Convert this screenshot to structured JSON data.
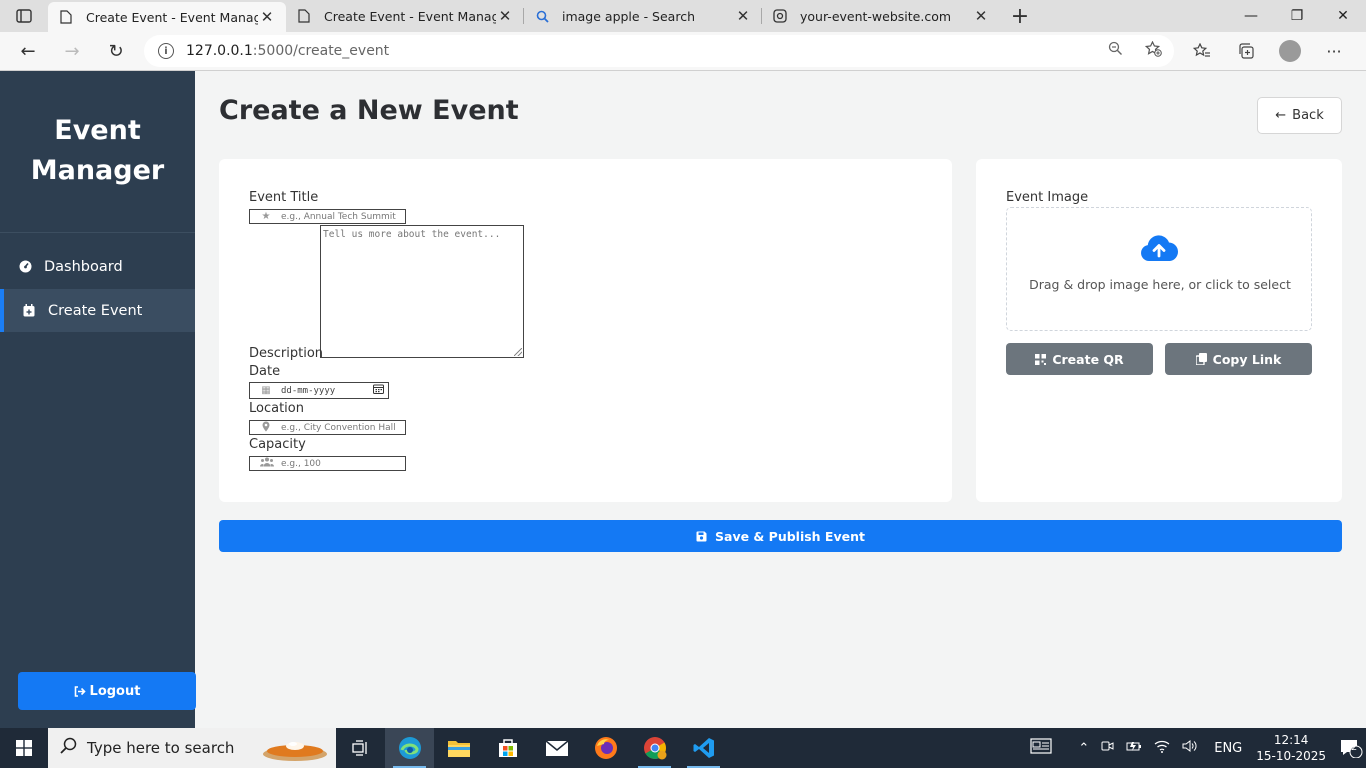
{
  "browser": {
    "tabs": [
      {
        "title": "Create Event - Event Manager",
        "icon": "page-icon",
        "active": true
      },
      {
        "title": "Create Event - Event Manager",
        "icon": "page-icon",
        "active": false
      },
      {
        "title": "image apple - Search",
        "icon": "search-icon",
        "active": false
      },
      {
        "title": "your-event-website.com",
        "icon": "page-icon",
        "active": false
      }
    ],
    "url_host": "127.0.0.1",
    "url_path": ":5000/create_event"
  },
  "sidebar": {
    "brand_line1": "Event",
    "brand_line2": "Manager",
    "items": [
      {
        "label": "Dashboard",
        "icon": "gauge-icon",
        "active": false
      },
      {
        "label": "Create Event",
        "icon": "calendar-plus-icon",
        "active": true
      }
    ],
    "logout_label": "Logout"
  },
  "main": {
    "title": "Create a New Event",
    "back_label": "Back",
    "form": {
      "title_label": "Event Title",
      "title_placeholder": "e.g., Annual Tech Summit",
      "description_label": "Description",
      "description_placeholder": "Tell us more about the event...",
      "date_label": "Date",
      "date_placeholder": "dd-mm-yyyy",
      "location_label": "Location",
      "location_placeholder": "e.g., City Convention Hall",
      "capacity_label": "Capacity",
      "capacity_placeholder": "e.g., 100"
    },
    "image": {
      "label": "Event Image",
      "drop_text": "Drag & drop image here, or click to select",
      "create_qr_label": "Create QR",
      "copy_link_label": "Copy Link"
    },
    "save_label": "Save & Publish Event"
  },
  "taskbar": {
    "search_placeholder": "Type here to search",
    "language": "ENG",
    "time": "12:14",
    "date": "15-10-2025",
    "notification_count": "2"
  },
  "colors": {
    "sidebar_bg": "#2d3e50",
    "primary": "#1479f4",
    "secondary": "#6c757d"
  }
}
